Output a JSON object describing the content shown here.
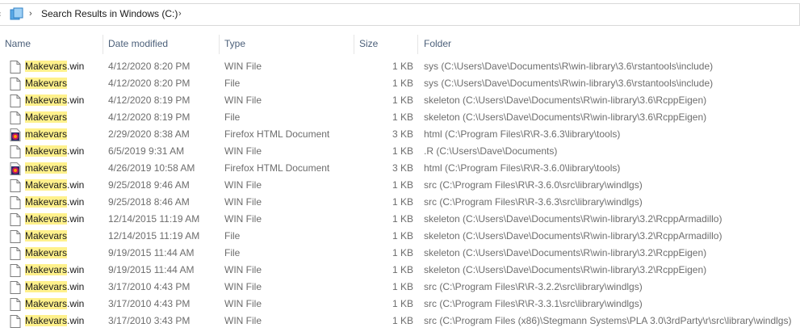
{
  "address": {
    "location": "Search Results in Windows (C:)",
    "sep1": "›",
    "sep2": "›"
  },
  "columns": {
    "name": "Name",
    "date": "Date modified",
    "type": "Type",
    "size": "Size",
    "folder": "Folder"
  },
  "search_term": "Makevars",
  "colors": {
    "highlight": "#fff18c",
    "header_text": "#4c607a",
    "firefox_icon": "#c2185b"
  },
  "rows": [
    {
      "match": "Makevars",
      "rest": ".win",
      "icon": "file-icon",
      "date": "4/12/2020 8:20 PM",
      "type": "WIN File",
      "size": "1 KB",
      "folder": "sys (C:\\Users\\Dave\\Documents\\R\\win-library\\3.6\\rstantools\\include)"
    },
    {
      "match": "Makevars",
      "rest": "",
      "icon": "file-icon",
      "date": "4/12/2020 8:20 PM",
      "type": "File",
      "size": "1 KB",
      "folder": "sys (C:\\Users\\Dave\\Documents\\R\\win-library\\3.6\\rstantools\\include)"
    },
    {
      "match": "Makevars",
      "rest": ".win",
      "icon": "file-icon",
      "date": "4/12/2020 8:19 PM",
      "type": "WIN File",
      "size": "1 KB",
      "folder": "skeleton (C:\\Users\\Dave\\Documents\\R\\win-library\\3.6\\RcppEigen)"
    },
    {
      "match": "Makevars",
      "rest": "",
      "icon": "file-icon",
      "date": "4/12/2020 8:19 PM",
      "type": "File",
      "size": "1 KB",
      "folder": "skeleton (C:\\Users\\Dave\\Documents\\R\\win-library\\3.6\\RcppEigen)"
    },
    {
      "match": "makevars",
      "rest": "",
      "icon": "firefox-document-icon",
      "date": "2/29/2020 8:38 AM",
      "type": "Firefox HTML Document",
      "size": "3 KB",
      "folder": "html (C:\\Program Files\\R\\R-3.6.3\\library\\tools)"
    },
    {
      "match": "Makevars",
      "rest": ".win",
      "icon": "file-icon",
      "date": "6/5/2019 9:31 AM",
      "type": "WIN File",
      "size": "1 KB",
      "folder": ".R (C:\\Users\\Dave\\Documents)"
    },
    {
      "match": "makevars",
      "rest": "",
      "icon": "firefox-document-icon",
      "date": "4/26/2019 10:58 AM",
      "type": "Firefox HTML Document",
      "size": "3 KB",
      "folder": "html (C:\\Program Files\\R\\R-3.6.0\\library\\tools)"
    },
    {
      "match": "Makevars",
      "rest": ".win",
      "icon": "file-icon",
      "date": "9/25/2018 9:46 AM",
      "type": "WIN File",
      "size": "1 KB",
      "folder": "src (C:\\Program Files\\R\\R-3.6.0\\src\\library\\windlgs)"
    },
    {
      "match": "Makevars",
      "rest": ".win",
      "icon": "file-icon",
      "date": "9/25/2018 8:46 AM",
      "type": "WIN File",
      "size": "1 KB",
      "folder": "src (C:\\Program Files\\R\\R-3.6.3\\src\\library\\windlgs)"
    },
    {
      "match": "Makevars",
      "rest": ".win",
      "icon": "file-icon",
      "date": "12/14/2015 11:19 AM",
      "type": "WIN File",
      "size": "1 KB",
      "folder": "skeleton (C:\\Users\\Dave\\Documents\\R\\win-library\\3.2\\RcppArmadillo)"
    },
    {
      "match": "Makevars",
      "rest": "",
      "icon": "file-icon",
      "date": "12/14/2015 11:19 AM",
      "type": "File",
      "size": "1 KB",
      "folder": "skeleton (C:\\Users\\Dave\\Documents\\R\\win-library\\3.2\\RcppArmadillo)"
    },
    {
      "match": "Makevars",
      "rest": "",
      "icon": "file-icon",
      "date": "9/19/2015 11:44 AM",
      "type": "File",
      "size": "1 KB",
      "folder": "skeleton (C:\\Users\\Dave\\Documents\\R\\win-library\\3.2\\RcppEigen)"
    },
    {
      "match": "Makevars",
      "rest": ".win",
      "icon": "file-icon",
      "date": "9/19/2015 11:44 AM",
      "type": "WIN File",
      "size": "1 KB",
      "folder": "skeleton (C:\\Users\\Dave\\Documents\\R\\win-library\\3.2\\RcppEigen)"
    },
    {
      "match": "Makevars",
      "rest": ".win",
      "icon": "file-icon",
      "date": "3/17/2010 4:43 PM",
      "type": "WIN File",
      "size": "1 KB",
      "folder": "src (C:\\Program Files\\R\\R-3.2.2\\src\\library\\windlgs)"
    },
    {
      "match": "Makevars",
      "rest": ".win",
      "icon": "file-icon",
      "date": "3/17/2010 4:43 PM",
      "type": "WIN File",
      "size": "1 KB",
      "folder": "src (C:\\Program Files\\R\\R-3.3.1\\src\\library\\windlgs)"
    },
    {
      "match": "Makevars",
      "rest": ".win",
      "icon": "file-icon",
      "date": "3/17/2010 3:43 PM",
      "type": "WIN File",
      "size": "1 KB",
      "folder": "src (C:\\Program Files (x86)\\Stegmann Systems\\PLA 3.0\\3rdParty\\r\\src\\library\\windlgs)"
    }
  ]
}
